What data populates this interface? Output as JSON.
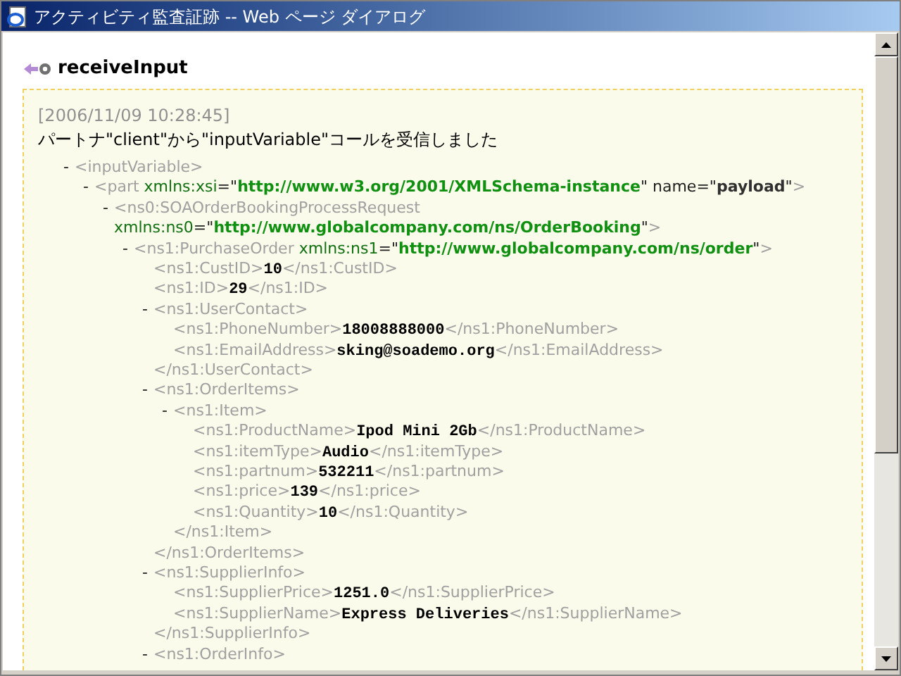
{
  "window": {
    "title": "アクティビティ監査証跡 -- Web ページ ダイアログ"
  },
  "heading": {
    "text": "receiveInput"
  },
  "log": {
    "timestamp": "[2006/11/09 10:28:45]",
    "message": "パートナ\"client\"から\"inputVariable\"コールを受信しました",
    "tree": [
      {
        "toggle": "-",
        "lines": [
          [
            {
              "kind": "tag",
              "text": "<inputVariable>"
            }
          ]
        ],
        "children": [
          {
            "toggle": "-",
            "lines": [
              [
                {
                  "kind": "tag",
                  "text": "<part "
                },
                {
                  "kind": "ns",
                  "text": "xmlns:xsi"
                },
                {
                  "kind": "plain",
                  "text": "=\""
                },
                {
                  "kind": "url",
                  "text": "http://www.w3.org/2001/XMLSchema-instance"
                },
                {
                  "kind": "plain",
                  "text": "\" name=\""
                },
                {
                  "kind": "bold",
                  "text": "payload"
                },
                {
                  "kind": "plain",
                  "text": "\""
                },
                {
                  "kind": "tag",
                  "text": ">"
                }
              ]
            ],
            "children": [
              {
                "toggle": "-",
                "lines": [
                  [
                    {
                      "kind": "tag",
                      "text": "<ns0:SOAOrderBookingProcessRequest"
                    }
                  ],
                  [
                    {
                      "kind": "ns",
                      "text": "xmlns:ns0"
                    },
                    {
                      "kind": "plain",
                      "text": "=\""
                    },
                    {
                      "kind": "url",
                      "text": "http://www.globalcompany.com/ns/OrderBooking"
                    },
                    {
                      "kind": "plain",
                      "text": "\""
                    },
                    {
                      "kind": "tag",
                      "text": ">"
                    }
                  ]
                ],
                "children": [
                  {
                    "toggle": "-",
                    "lines": [
                      [
                        {
                          "kind": "tag",
                          "text": "<ns1:PurchaseOrder "
                        },
                        {
                          "kind": "ns",
                          "text": "xmlns:ns1"
                        },
                        {
                          "kind": "plain",
                          "text": "=\""
                        },
                        {
                          "kind": "url",
                          "text": "http://www.globalcompany.com/ns/order"
                        },
                        {
                          "kind": "plain",
                          "text": "\""
                        },
                        {
                          "kind": "tag",
                          "text": ">"
                        }
                      ]
                    ],
                    "children": [
                      {
                        "lines": [
                          [
                            {
                              "kind": "tag",
                              "text": "<ns1:CustID>"
                            },
                            {
                              "kind": "value",
                              "text": "10"
                            },
                            {
                              "kind": "tag",
                              "text": "</ns1:CustID>"
                            }
                          ]
                        ]
                      },
                      {
                        "lines": [
                          [
                            {
                              "kind": "tag",
                              "text": "<ns1:ID>"
                            },
                            {
                              "kind": "value",
                              "text": "29"
                            },
                            {
                              "kind": "tag",
                              "text": "</ns1:ID>"
                            }
                          ]
                        ]
                      },
                      {
                        "toggle": "-",
                        "lines": [
                          [
                            {
                              "kind": "tag",
                              "text": "<ns1:UserContact>"
                            }
                          ]
                        ],
                        "children": [
                          {
                            "lines": [
                              [
                                {
                                  "kind": "tag",
                                  "text": "<ns1:PhoneNumber>"
                                },
                                {
                                  "kind": "value",
                                  "text": "18008888000"
                                },
                                {
                                  "kind": "tag",
                                  "text": "</ns1:PhoneNumber>"
                                }
                              ]
                            ]
                          },
                          {
                            "lines": [
                              [
                                {
                                  "kind": "tag",
                                  "text": "<ns1:EmailAddress>"
                                },
                                {
                                  "kind": "value",
                                  "text": "sking@soademo.org"
                                },
                                {
                                  "kind": "tag",
                                  "text": "</ns1:EmailAddress>"
                                }
                              ]
                            ]
                          }
                        ],
                        "closing": "</ns1:UserContact>"
                      },
                      {
                        "toggle": "-",
                        "lines": [
                          [
                            {
                              "kind": "tag",
                              "text": "<ns1:OrderItems>"
                            }
                          ]
                        ],
                        "children": [
                          {
                            "toggle": "-",
                            "lines": [
                              [
                                {
                                  "kind": "tag",
                                  "text": "<ns1:Item>"
                                }
                              ]
                            ],
                            "children": [
                              {
                                "lines": [
                                  [
                                    {
                                      "kind": "tag",
                                      "text": "<ns1:ProductName>"
                                    },
                                    {
                                      "kind": "value",
                                      "text": "Ipod Mini 2Gb"
                                    },
                                    {
                                      "kind": "tag",
                                      "text": "</ns1:ProductName>"
                                    }
                                  ]
                                ]
                              },
                              {
                                "lines": [
                                  [
                                    {
                                      "kind": "tag",
                                      "text": "<ns1:itemType>"
                                    },
                                    {
                                      "kind": "value",
                                      "text": "Audio"
                                    },
                                    {
                                      "kind": "tag",
                                      "text": "</ns1:itemType>"
                                    }
                                  ]
                                ]
                              },
                              {
                                "lines": [
                                  [
                                    {
                                      "kind": "tag",
                                      "text": "<ns1:partnum>"
                                    },
                                    {
                                      "kind": "value",
                                      "text": "532211"
                                    },
                                    {
                                      "kind": "tag",
                                      "text": "</ns1:partnum>"
                                    }
                                  ]
                                ]
                              },
                              {
                                "lines": [
                                  [
                                    {
                                      "kind": "tag",
                                      "text": "<ns1:price>"
                                    },
                                    {
                                      "kind": "value",
                                      "text": "139"
                                    },
                                    {
                                      "kind": "tag",
                                      "text": "</ns1:price>"
                                    }
                                  ]
                                ]
                              },
                              {
                                "lines": [
                                  [
                                    {
                                      "kind": "tag",
                                      "text": "<ns1:Quantity>"
                                    },
                                    {
                                      "kind": "value",
                                      "text": "10"
                                    },
                                    {
                                      "kind": "tag",
                                      "text": "</ns1:Quantity>"
                                    }
                                  ]
                                ]
                              }
                            ],
                            "closing": "</ns1:Item>"
                          }
                        ],
                        "closing": "</ns1:OrderItems>"
                      },
                      {
                        "toggle": "-",
                        "lines": [
                          [
                            {
                              "kind": "tag",
                              "text": "<ns1:SupplierInfo>"
                            }
                          ]
                        ],
                        "children": [
                          {
                            "lines": [
                              [
                                {
                                  "kind": "tag",
                                  "text": "<ns1:SupplierPrice>"
                                },
                                {
                                  "kind": "value",
                                  "text": "1251.0"
                                },
                                {
                                  "kind": "tag",
                                  "text": "</ns1:SupplierPrice>"
                                }
                              ]
                            ]
                          },
                          {
                            "lines": [
                              [
                                {
                                  "kind": "tag",
                                  "text": "<ns1:SupplierName>"
                                },
                                {
                                  "kind": "value",
                                  "text": "Express Deliveries"
                                },
                                {
                                  "kind": "tag",
                                  "text": "</ns1:SupplierName>"
                                }
                              ]
                            ]
                          }
                        ],
                        "closing": "</ns1:SupplierInfo>"
                      },
                      {
                        "toggle": "-",
                        "lines": [
                          [
                            {
                              "kind": "tag",
                              "text": "<ns1:OrderInfo>"
                            }
                          ]
                        ]
                      }
                    ]
                  }
                ]
              }
            ]
          }
        ]
      }
    ]
  }
}
